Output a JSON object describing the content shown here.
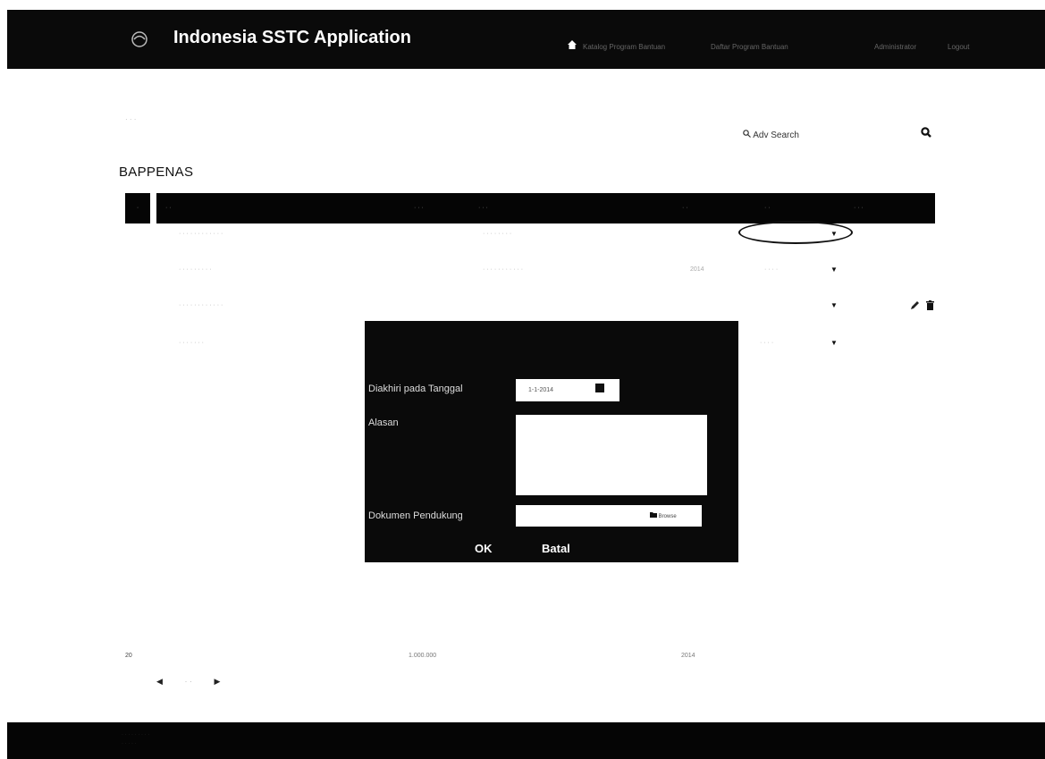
{
  "header": {
    "title": "Indonesia SSTC Application",
    "nav": [
      "Katalog Program Bantuan",
      "Daftar Program Bantuan",
      "Administrator",
      "Logout"
    ]
  },
  "toolbar": {
    "adv_search_label": "Adv Search"
  },
  "page": {
    "org_title": "BAPPENAS"
  },
  "row_values": {
    "year": "2014",
    "last_number": "20",
    "amount": "1.000.000"
  },
  "modal": {
    "end_date_label": "Diakhiri pada Tanggal",
    "end_date_value": "1-1-2014",
    "reason_label": "Alasan",
    "doc_label": "Dokumen Pendukung",
    "browse_label": "Browse",
    "ok_label": "OK",
    "cancel_label": "Batal"
  },
  "icons": [
    "logo-icon",
    "home-icon",
    "adv-search-icon",
    "search-icon",
    "calendar-icon",
    "folder-icon",
    "edit-icon",
    "delete-icon",
    "caret-down-icon",
    "prev-icon",
    "next-icon"
  ],
  "colors": {
    "bar": "#050505",
    "page": "#ffffff",
    "highlight_oval": "#111111"
  }
}
